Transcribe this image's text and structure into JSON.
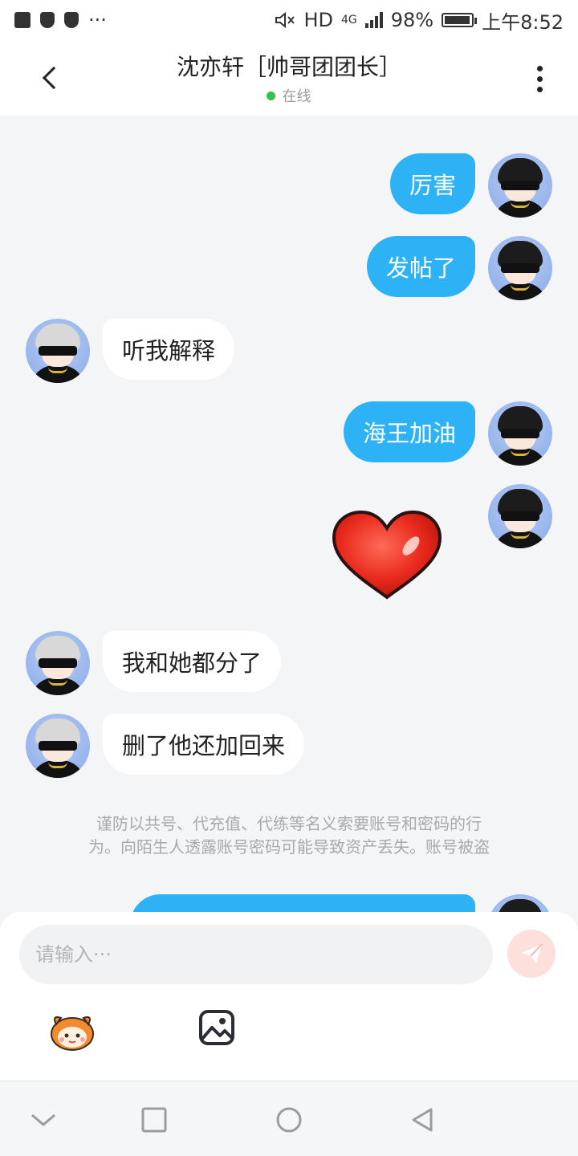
{
  "status_bar": {
    "left_icons": [
      "message-icon",
      "shield-icon",
      "shield-icon",
      "more-dots"
    ],
    "more": "···",
    "hd": "HD",
    "network": "4G",
    "battery_percent": "98%",
    "battery_level": 0.98,
    "time": "上午8:52"
  },
  "header": {
    "back_icon": "chevron-left-icon",
    "title": "沈亦轩［帅哥团团长］",
    "status": "在线",
    "status_color": "#35c24a",
    "more_icon": "more-vertical-icon"
  },
  "messages": [
    {
      "side": "out",
      "text": "厉害"
    },
    {
      "side": "out",
      "text": "发帖了"
    },
    {
      "side": "in",
      "text": "听我解释"
    },
    {
      "side": "out",
      "text": "海王加油"
    },
    {
      "side": "out",
      "sticker": "heart-sticker"
    },
    {
      "side": "in",
      "text": "我和她都分了"
    },
    {
      "side": "in",
      "text": "删了他还加回来"
    },
    {
      "side": "out",
      "text": ""
    }
  ],
  "notice": {
    "line1": "谨防以共号、代充值、代练等名义索要账号和密码的行",
    "line2": "为。向陌生人透露账号密码可能导致资产丢失。账号被盗"
  },
  "input": {
    "placeholder": "请输入···",
    "send_icon": "send-icon",
    "tools": [
      "emoji-mascot-icon",
      "image-icon"
    ]
  },
  "nav_bar": {
    "buttons": [
      "collapse-icon",
      "recents-icon",
      "home-icon",
      "back-icon"
    ]
  },
  "colors": {
    "accent": "#2db2f6",
    "background": "#f4f5f7",
    "notice_text": "#a7a9ad",
    "send_button": "#fde0dc"
  }
}
